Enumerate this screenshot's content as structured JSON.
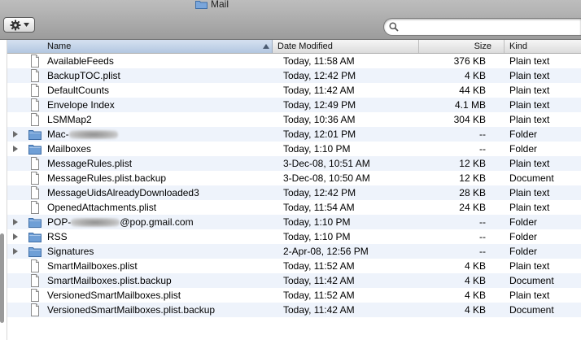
{
  "window": {
    "title": "Mail"
  },
  "toolbar": {
    "search": {
      "value": "",
      "placeholder": ""
    }
  },
  "columns": {
    "name": "Name",
    "date": "Date Modified",
    "size": "Size",
    "kind": "Kind"
  },
  "files": [
    {
      "name": "AvailableFeeds",
      "date": "Today, 11:58 AM",
      "size": "376 KB",
      "kind": "Plain text",
      "type": "file"
    },
    {
      "name": "BackupTOC.plist",
      "date": "Today, 12:42 PM",
      "size": "4 KB",
      "kind": "Plain text",
      "type": "file"
    },
    {
      "name": "DefaultCounts",
      "date": "Today, 11:42 AM",
      "size": "44 KB",
      "kind": "Plain text",
      "type": "file"
    },
    {
      "name": "Envelope Index",
      "date": "Today, 12:49 PM",
      "size": "4.1 MB",
      "kind": "Plain text",
      "type": "file"
    },
    {
      "name": "LSMMap2",
      "date": "Today, 10:36 AM",
      "size": "304 KB",
      "kind": "Plain text",
      "type": "file"
    },
    {
      "name": "Mac-",
      "name_after": "",
      "redacted": true,
      "date": "Today, 12:01 PM",
      "size": "--",
      "kind": "Folder",
      "type": "folder"
    },
    {
      "name": "Mailboxes",
      "date": "Today, 1:10 PM",
      "size": "--",
      "kind": "Folder",
      "type": "folder"
    },
    {
      "name": "MessageRules.plist",
      "date": "3-Dec-08, 10:51 AM",
      "size": "12 KB",
      "kind": "Plain text",
      "type": "file"
    },
    {
      "name": "MessageRules.plist.backup",
      "date": "3-Dec-08, 10:50 AM",
      "size": "12 KB",
      "kind": "Document",
      "type": "file"
    },
    {
      "name": "MessageUidsAlreadyDownloaded3",
      "date": "Today, 12:42 PM",
      "size": "28 KB",
      "kind": "Plain text",
      "type": "file"
    },
    {
      "name": "OpenedAttachments.plist",
      "date": "Today, 11:54 AM",
      "size": "24 KB",
      "kind": "Plain text",
      "type": "file"
    },
    {
      "name": "POP-",
      "name_after": "@pop.gmail.com",
      "redacted": true,
      "date": "Today, 1:10 PM",
      "size": "--",
      "kind": "Folder",
      "type": "folder"
    },
    {
      "name": "RSS",
      "date": "Today, 1:10 PM",
      "size": "--",
      "kind": "Folder",
      "type": "folder"
    },
    {
      "name": "Signatures",
      "date": "2-Apr-08, 12:56 PM",
      "size": "--",
      "kind": "Folder",
      "type": "folder"
    },
    {
      "name": "SmartMailboxes.plist",
      "date": "Today, 11:52 AM",
      "size": "4 KB",
      "kind": "Plain text",
      "type": "file"
    },
    {
      "name": "SmartMailboxes.plist.backup",
      "date": "Today, 11:42 AM",
      "size": "4 KB",
      "kind": "Document",
      "type": "file"
    },
    {
      "name": "VersionedSmartMailboxes.plist",
      "date": "Today, 11:52 AM",
      "size": "4 KB",
      "kind": "Plain text",
      "type": "file"
    },
    {
      "name": "VersionedSmartMailboxes.plist.backup",
      "date": "Today, 11:42 AM",
      "size": "4 KB",
      "kind": "Document",
      "type": "file"
    }
  ],
  "colors": {
    "folder": "#6f9fd6",
    "row_stripe": "#eef3fb",
    "sorted_header": "#c4d4ea"
  }
}
